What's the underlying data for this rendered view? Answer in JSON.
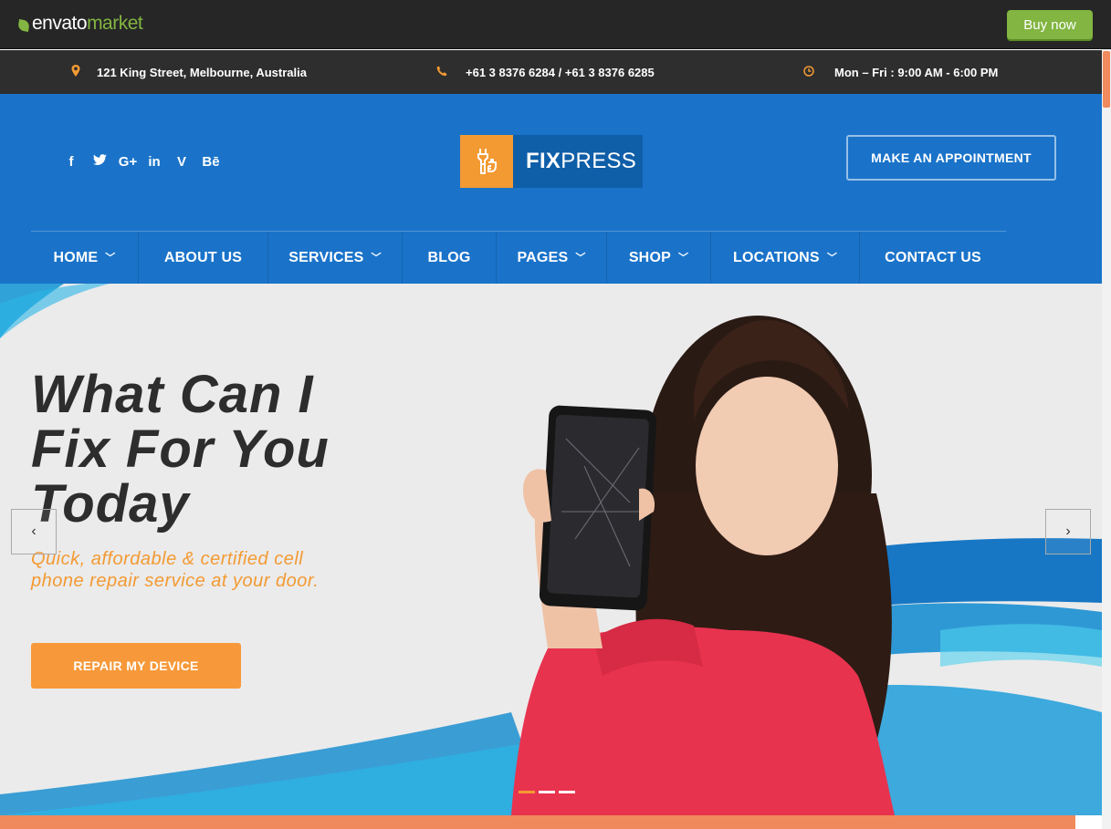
{
  "envato": {
    "logo_main": "envato",
    "logo_market": "market",
    "buy_label": "Buy now"
  },
  "info_bar": {
    "address": "121 King Street, Melbourne, Australia",
    "phone": "+61 3 8376 6284 / +61 3 8376 6285",
    "hours": "Mon – Fri : 9:00 AM - 6:00 PM"
  },
  "header": {
    "socials": [
      {
        "icon": "facebook-icon",
        "glyph": "f"
      },
      {
        "icon": "twitter-icon",
        "glyph": "🐦"
      },
      {
        "icon": "google-plus-icon",
        "glyph": "G+"
      },
      {
        "icon": "linkedin-icon",
        "glyph": "in"
      },
      {
        "icon": "vimeo-icon",
        "glyph": "V"
      },
      {
        "icon": "behance-icon",
        "glyph": "Bē"
      }
    ],
    "logo_bold": "FIX",
    "logo_rest": "PRESS",
    "appointment_label": "MAKE AN APPOINTMENT"
  },
  "nav": {
    "items": [
      {
        "label": "HOME",
        "dropdown": true
      },
      {
        "label": "ABOUT US",
        "dropdown": false
      },
      {
        "label": "SERVICES",
        "dropdown": true
      },
      {
        "label": "BLOG",
        "dropdown": false
      },
      {
        "label": "PAGES",
        "dropdown": true
      },
      {
        "label": "SHOP",
        "dropdown": true
      },
      {
        "label": "LOCATIONS",
        "dropdown": true
      },
      {
        "label": "CONTACT US",
        "dropdown": false
      }
    ]
  },
  "hero": {
    "title_lines": [
      "What Can I",
      "Fix For You",
      "Today"
    ],
    "subtitle_lines": [
      "Quick, affordable & certified cell",
      "phone repair service at your door."
    ],
    "cta_label": "REPAIR MY DEVICE",
    "prev_glyph": "‹",
    "next_glyph": "›",
    "slide_count": 3,
    "active_slide": 1
  },
  "colors": {
    "envato_green": "#82b541",
    "header_blue": "#1a73c9",
    "accent_orange": "#f39a33",
    "dark_bar": "#2e2e2e"
  }
}
